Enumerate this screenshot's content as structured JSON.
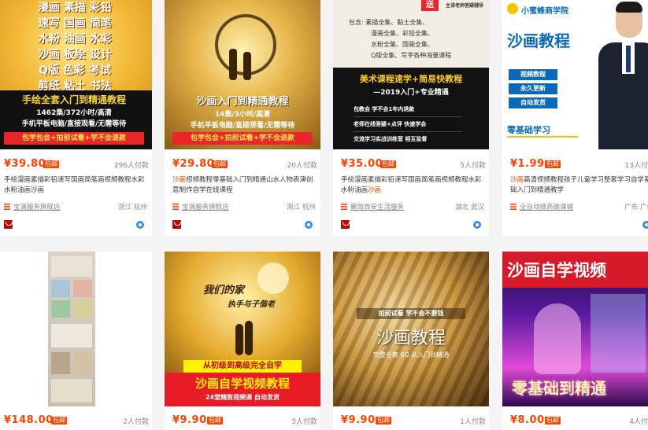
{
  "products": [
    {
      "image_text": [
        "漫画 素描 彩铅",
        "速写 国画 简笔",
        "水粉 油画 水彩",
        "沙画 板绘 设计",
        "Q版 色彩 考试",
        "剪纸 粘土 书法",
        "手绘全套入门到精通教程",
        "1462集/372小时/高清",
        "手机平板电脑/直接观看/无需等待",
        "包学包会+拍前试看+学不会退款"
      ],
      "price": "¥39.80",
      "badge": "包邮",
      "buyers": "296人付款",
      "title_pre": "手绘漫画素描彩铅速写国画简笔画视频教",
      "title_hl": "",
      "title_post": "程水彩水粉油画沙画",
      "shop": "宝满服务旗舰店",
      "location": "浙江 杭州"
    },
    {
      "image_text": [
        "沙画入门到精通教程",
        "14集/3小时/高清",
        "手机平板电脑/直接观看/无需等待",
        "包学包会+拍前试看+学不会退款"
      ],
      "price": "¥29.80",
      "badge": "包邮",
      "buyers": "20人付款",
      "title_pre": "",
      "title_hl": "沙画",
      "title_post": "视频教程零基础入门到精通山水人物表演创意制作自学在线课程",
      "shop": "宝满服务旗舰店",
      "location": "浙江 杭州"
    },
    {
      "image_text": [
        "送",
        "主讲老师答疑辅导",
        "包含: 素描全集、黏土全集、",
        "漫画全集、彩铅全集、",
        "水粉全集、国画全集、",
        "Q版全集、写字各种海量课程",
        "美术课程速学+简易快教程",
        "—2019入门+专业精通",
        "包教会 学不会1年内退款",
        "老师在线答疑+点评 快速学会",
        "交流学习实战训练营 相互监督"
      ],
      "price": "¥35.00",
      "badge": "包邮",
      "buyers": "5人付款",
      "title_pre": "手绘漫画素描彩铅速写国画简笔画视频教程水彩水粉油画",
      "title_hl": "沙画",
      "title_post": "",
      "shop": "聚简西安生活服务",
      "location": "湖北 武汉"
    },
    {
      "image_text": [
        "小蜜蜂商学院",
        "沙画教程",
        "视频教程",
        "永久更新",
        "自动发货",
        "零基础学习"
      ],
      "price": "¥1.99",
      "badge": "包邮",
      "buyers": "13人付款",
      "title_pre": "",
      "title_hl": "沙画",
      "title_post": "高清视频教程孩子儿童学习整套学习自学基础入门到精通教学",
      "shop": "全自动微商微课铺",
      "location": "广东 广州"
    },
    {
      "image_text": [],
      "price": "¥148.00",
      "badge": "包邮",
      "buyers": "2人付款"
    },
    {
      "image_text": [
        "我们的家",
        "执手与子偕老",
        "从初级到高级完全自学",
        "沙画自学视频教程",
        "24堂精致视频课 自动发货"
      ],
      "price": "¥9.90",
      "badge": "包邮",
      "buyers": "3人付款"
    },
    {
      "image_text": [
        "拍前试看 学不会不要钱",
        "沙画教程",
        "完整全套 6G 从入门到精通"
      ],
      "price": "¥9.90",
      "badge": "包邮",
      "buyers": "1人付款"
    },
    {
      "image_text": [
        "沙画自学视频",
        "零基础到精通"
      ],
      "price": "¥8.00",
      "badge": "包邮",
      "buyers": "4人付款"
    }
  ]
}
